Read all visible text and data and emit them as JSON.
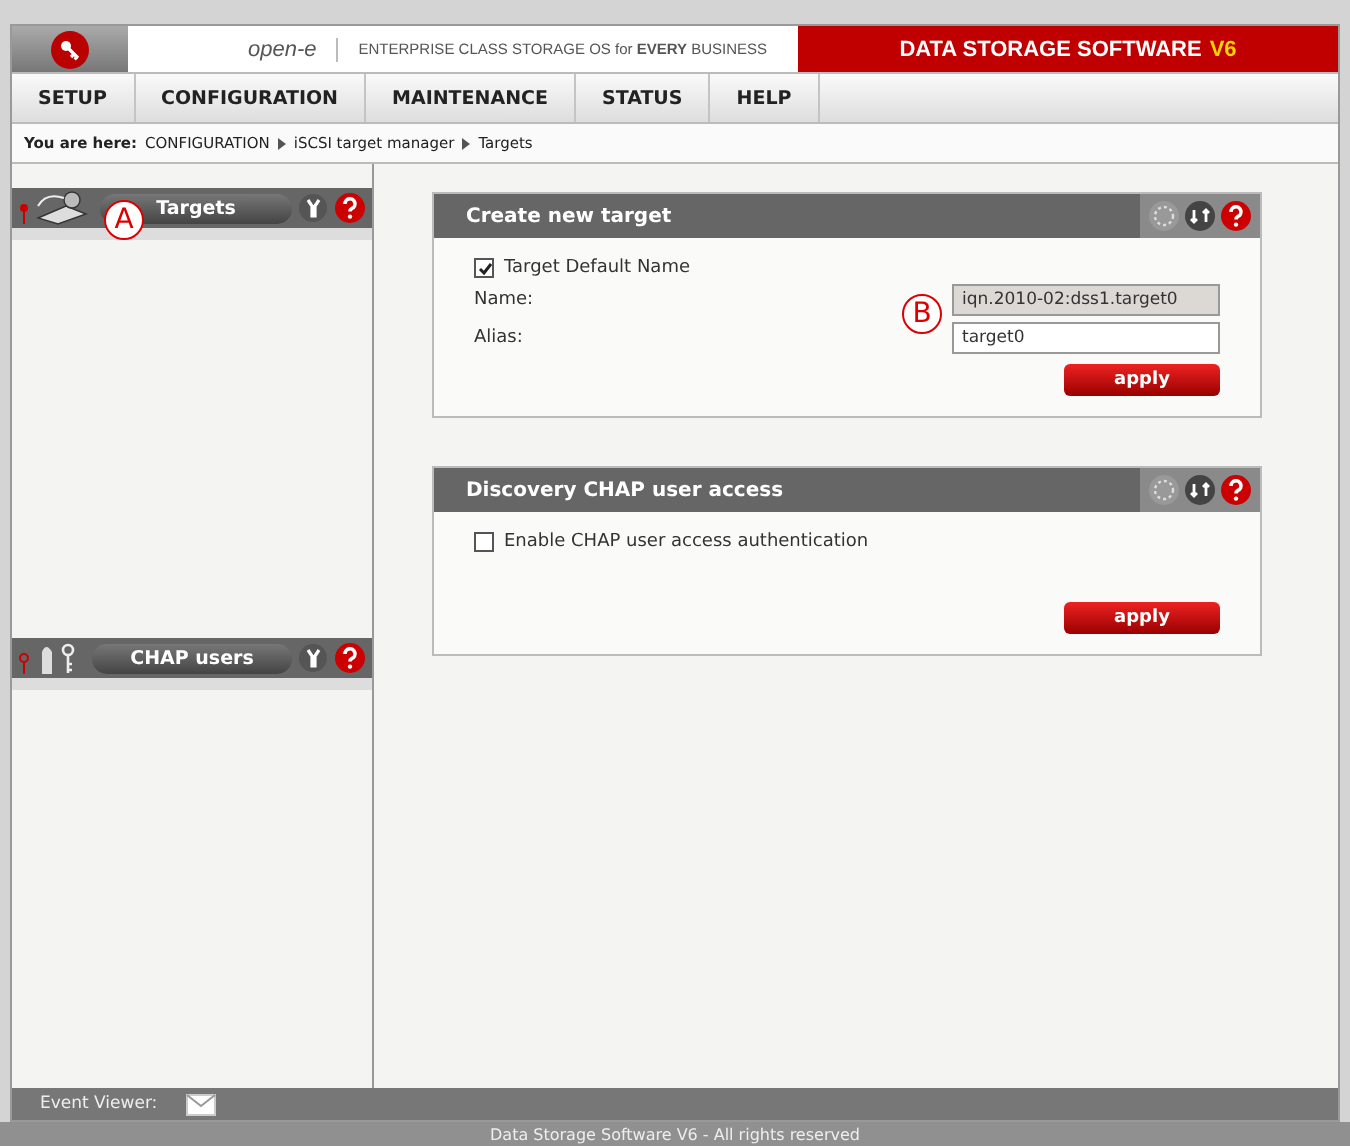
{
  "header": {
    "logo": "open-e",
    "tagline": "ENTERPRISE CLASS STORAGE OS for **EVERY** BUSINESS",
    "product": "DATA STORAGE SOFTWARE",
    "version": "V6"
  },
  "menu": [
    {
      "label": "SETUP"
    },
    {
      "label": "CONFIGURATION"
    },
    {
      "label": "MAINTENANCE"
    },
    {
      "label": "STATUS"
    },
    {
      "label": "HELP"
    }
  ],
  "breadcrumb": {
    "prefix": "You are here:",
    "items": [
      "CONFIGURATION",
      "iSCSI target manager",
      "Targets"
    ]
  },
  "sidebar": [
    {
      "kind": "targets",
      "title": "Targets",
      "callout": "A"
    },
    {
      "kind": "users",
      "title": "CHAP users"
    }
  ],
  "panels": [
    {
      "title": "Create new target",
      "checkbox": {
        "label": "Target Default Name",
        "checked": true
      },
      "fields": [
        {
          "label": "Name:",
          "value": "iqn.2010-02:dss1.target0",
          "disabled": true
        },
        {
          "label": "Alias:",
          "value": "target0",
          "disabled": false
        }
      ],
      "callout": "B",
      "button": "apply"
    },
    {
      "title": "Discovery CHAP user access",
      "checkbox": {
        "label": "Enable CHAP user access authentication",
        "checked": false
      },
      "button": "apply"
    }
  ],
  "event_bar": {
    "label": "Event Viewer:"
  },
  "footer": "Data Storage Software V6 - All rights reserved"
}
